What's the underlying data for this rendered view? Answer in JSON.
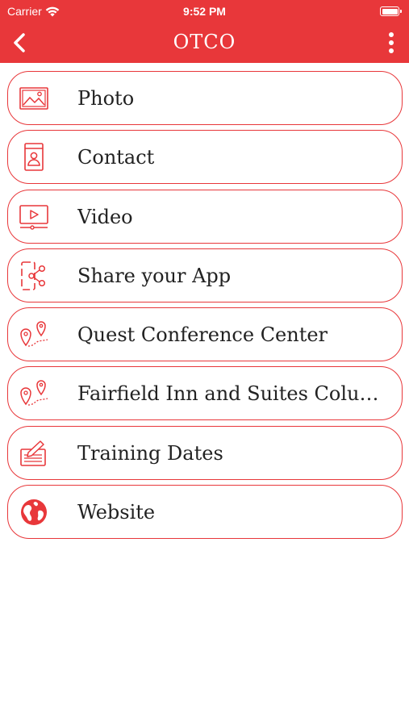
{
  "status_bar": {
    "carrier": "Carrier",
    "time": "9:52 PM"
  },
  "header": {
    "title": "OTCO",
    "accent_color": "#e8373a"
  },
  "menu": {
    "items": [
      {
        "label": "Photo",
        "icon": "photo-icon"
      },
      {
        "label": "Contact",
        "icon": "contact-card-icon"
      },
      {
        "label": "Video",
        "icon": "video-player-icon"
      },
      {
        "label": "Share your App",
        "icon": "share-icon"
      },
      {
        "label": "Quest Conference Center",
        "icon": "map-route-icon"
      },
      {
        "label": "Fairfield Inn and Suites Colum...",
        "icon": "map-route-icon"
      },
      {
        "label": "Training Dates",
        "icon": "edit-calendar-icon"
      },
      {
        "label": "Website",
        "icon": "globe-icon"
      }
    ]
  }
}
